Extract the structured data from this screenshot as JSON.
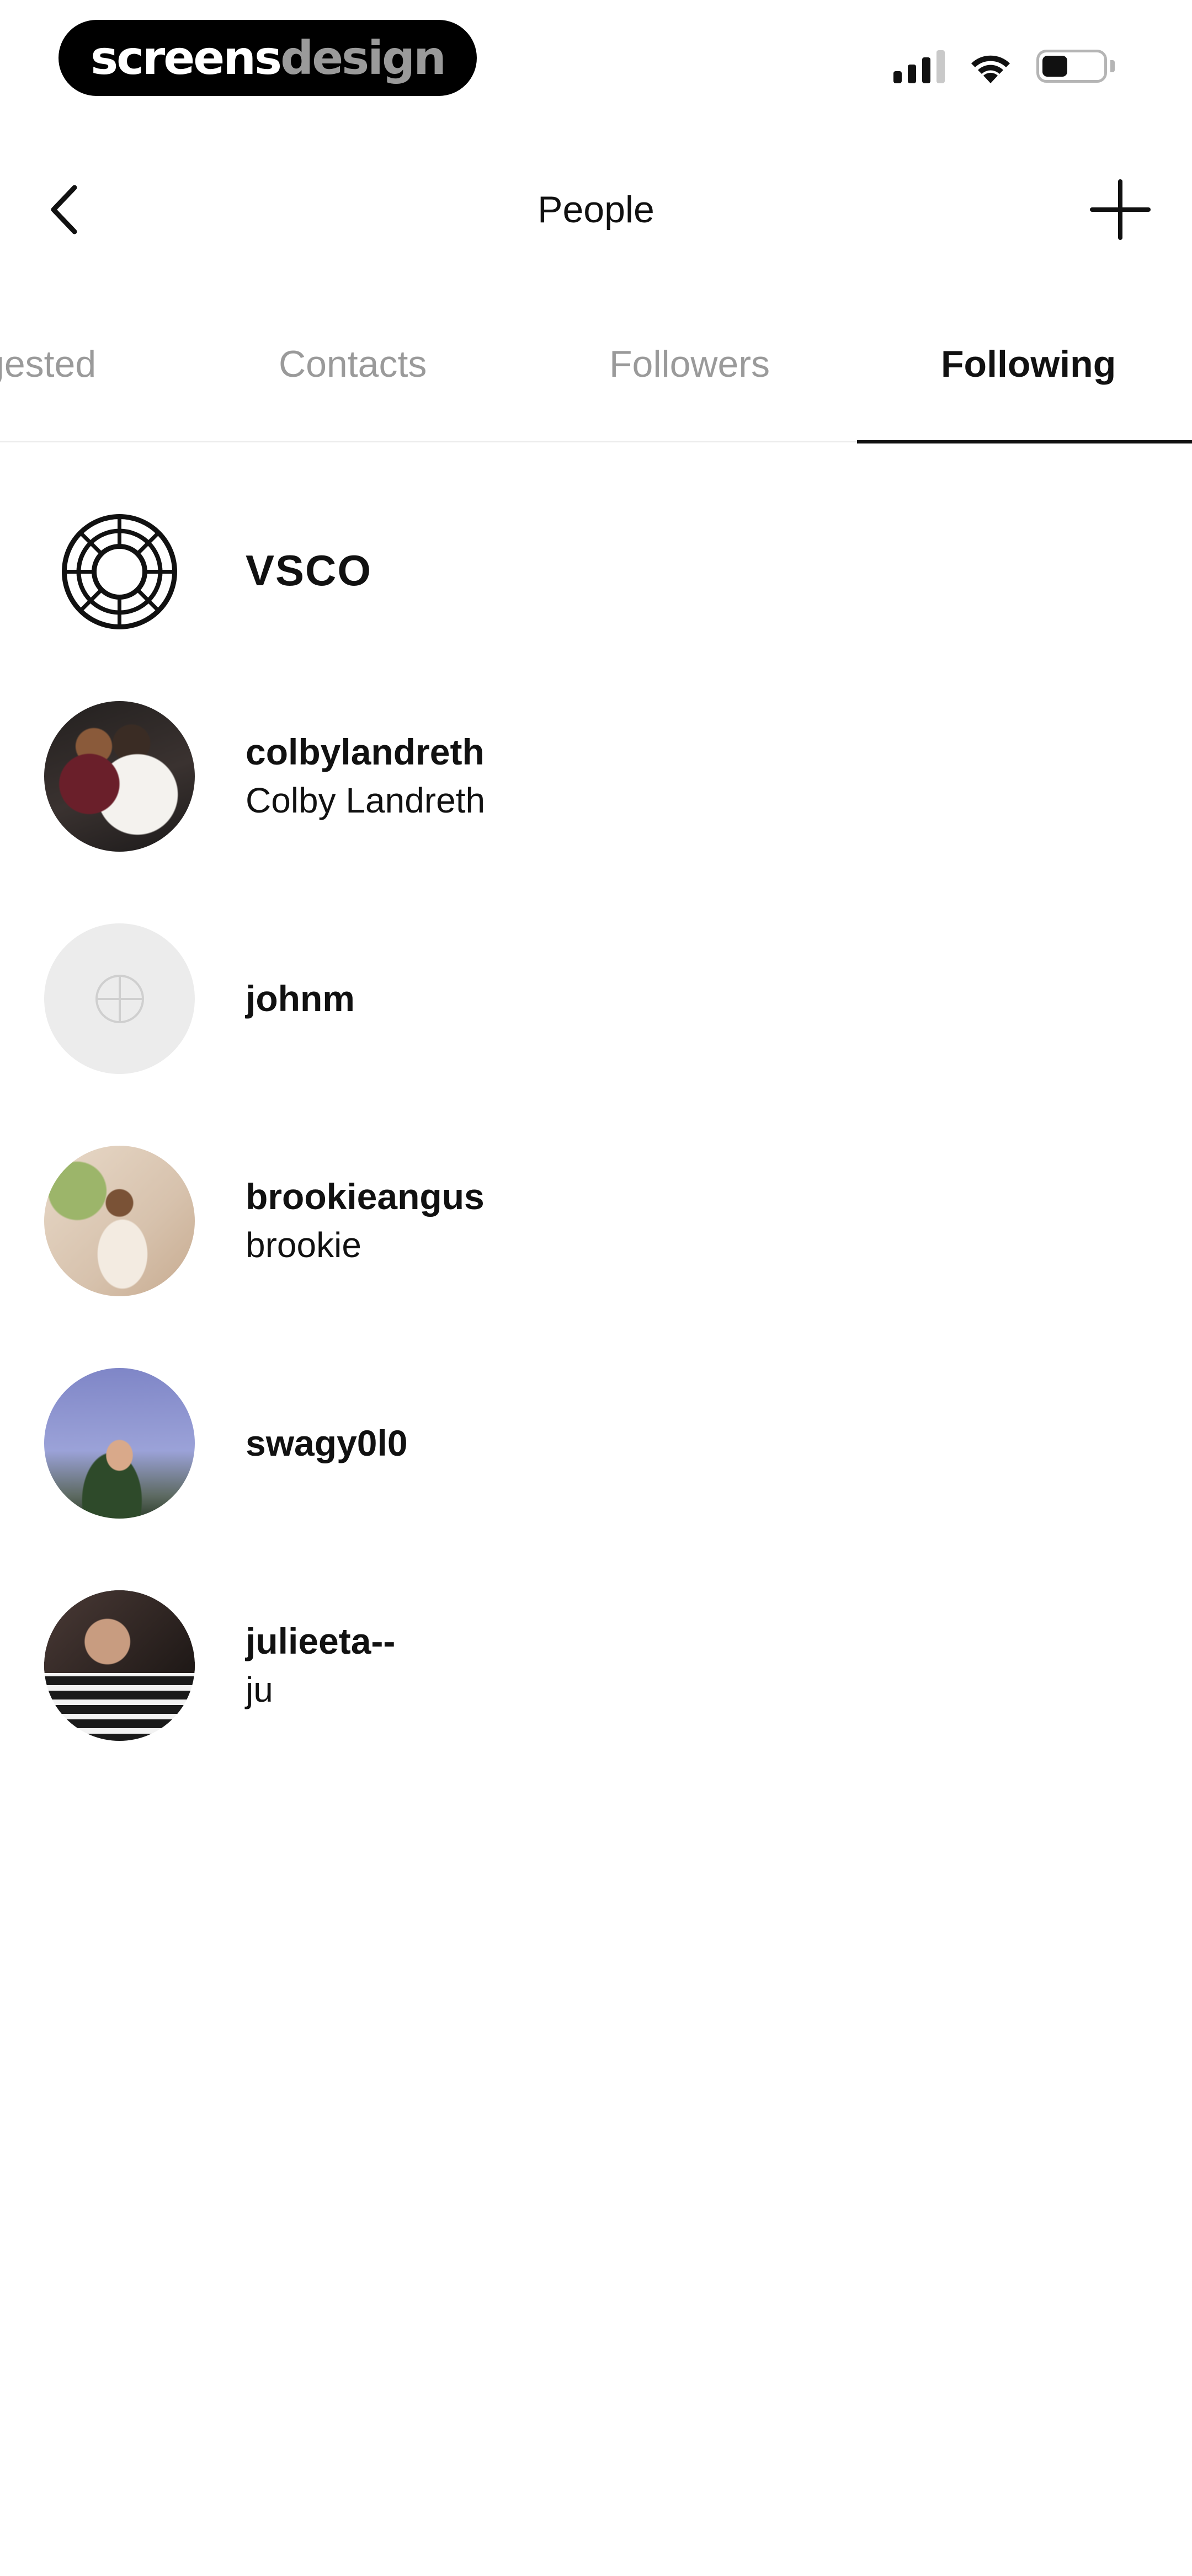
{
  "status_bar": {
    "brand_part1": "screens",
    "brand_part2": "design",
    "icons": [
      "cellular-signal-icon",
      "wifi-icon",
      "battery-icon"
    ]
  },
  "header": {
    "title": "People",
    "back_icon": "chevron-left-icon",
    "add_icon": "plus-icon"
  },
  "tabs": [
    {
      "label": "gested",
      "active": false
    },
    {
      "label": "Contacts",
      "active": false
    },
    {
      "label": "Followers",
      "active": false
    },
    {
      "label": "Following",
      "active": true
    }
  ],
  "people": [
    {
      "username": "VSCO",
      "fullname": "",
      "avatar": "vsco-logo-icon"
    },
    {
      "username": "colbylandreth",
      "fullname": "Colby Landreth",
      "avatar": "profile-photo"
    },
    {
      "username": "johnm",
      "fullname": "",
      "avatar": "default-avatar-icon"
    },
    {
      "username": "brookieangus",
      "fullname": "brookie",
      "avatar": "profile-photo"
    },
    {
      "username": "swagy0l0",
      "fullname": "",
      "avatar": "profile-photo"
    },
    {
      "username": "julieeta--",
      "fullname": "ju",
      "avatar": "profile-photo"
    }
  ],
  "colors": {
    "text": "#111111",
    "inactive_tab": "#9a9a9a",
    "divider": "#ececec",
    "placeholder_avatar": "#ececec"
  }
}
